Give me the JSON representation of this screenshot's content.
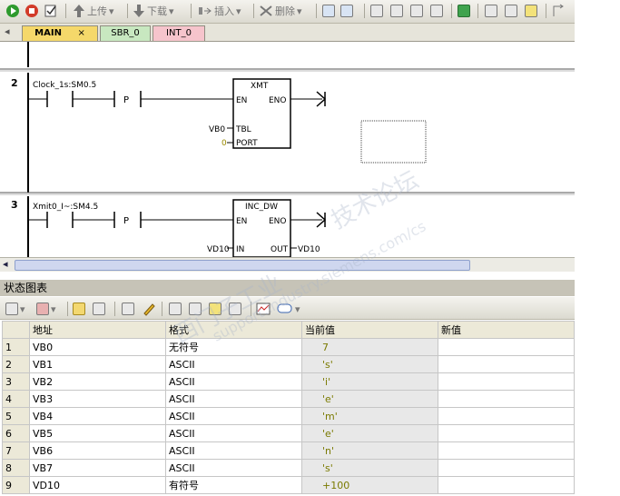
{
  "toolbar": {
    "upload": "上传",
    "download": "下载",
    "insert": "插入",
    "delete": "删除"
  },
  "tabs": [
    {
      "label": "MAIN"
    },
    {
      "label": "SBR_0"
    },
    {
      "label": "INT_0"
    }
  ],
  "ladder": {
    "network2": {
      "number": "2",
      "contact_label": "Clock_1s:SM0.5",
      "p_label": "P",
      "box_title": "XMT",
      "en": "EN",
      "eno": "ENO",
      "tbl": "TBL",
      "port": "PORT",
      "tbl_value": "VB0",
      "port_value": "0"
    },
    "network3": {
      "number": "3",
      "contact_label": "Xmit0_I~:SM4.5",
      "p_label": "P",
      "box_title": "INC_DW",
      "en": "EN",
      "eno": "ENO",
      "in": "IN",
      "out": "OUT",
      "in_value": "VD10",
      "out_value": "VD10"
    }
  },
  "status_chart": {
    "title": "状态图表",
    "columns": [
      "地址",
      "格式",
      "当前值",
      "新值"
    ],
    "rows": [
      {
        "n": "1",
        "addr": "VB0",
        "fmt": "无符号",
        "cur": "7",
        "newv": ""
      },
      {
        "n": "2",
        "addr": "VB1",
        "fmt": "ASCII",
        "cur": "'s'",
        "newv": ""
      },
      {
        "n": "3",
        "addr": "VB2",
        "fmt": "ASCII",
        "cur": "'i'",
        "newv": ""
      },
      {
        "n": "4",
        "addr": "VB3",
        "fmt": "ASCII",
        "cur": "'e'",
        "newv": ""
      },
      {
        "n": "5",
        "addr": "VB4",
        "fmt": "ASCII",
        "cur": "'m'",
        "newv": ""
      },
      {
        "n": "6",
        "addr": "VB5",
        "fmt": "ASCII",
        "cur": "'e'",
        "newv": ""
      },
      {
        "n": "7",
        "addr": "VB6",
        "fmt": "ASCII",
        "cur": "'n'",
        "newv": ""
      },
      {
        "n": "8",
        "addr": "VB7",
        "fmt": "ASCII",
        "cur": "'s'",
        "newv": ""
      },
      {
        "n": "9",
        "addr": "VD10",
        "fmt": "有符号",
        "cur": "+100",
        "newv": ""
      }
    ]
  },
  "watermark": {
    "line1": "西门子工业",
    "line2": "support.industry.siemens.com/cs",
    "line3": "技术论坛"
  },
  "colors": {
    "active_tab": "#f5d86a",
    "sbr_tab": "#c8e8c0",
    "int_tab": "#f6c4cc"
  }
}
